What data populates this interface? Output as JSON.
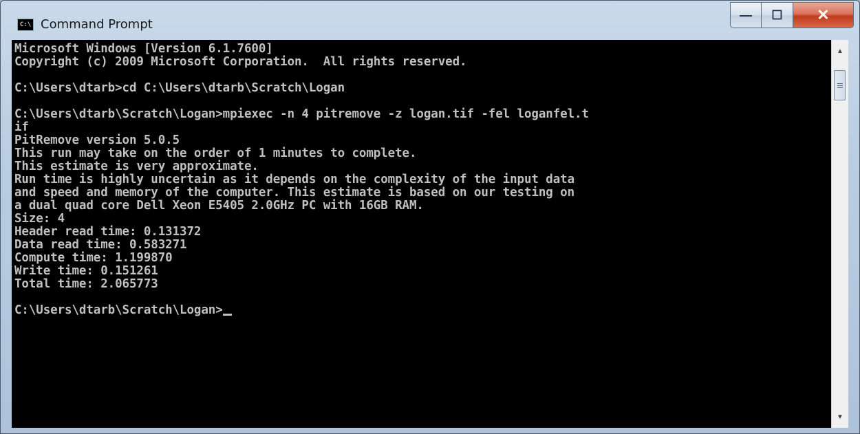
{
  "window": {
    "title": "Command Prompt",
    "icon": "console-app-icon",
    "icon_text": "C:\\",
    "minimize_glyph": "—",
    "maximize_glyph": "☐",
    "close_glyph": "✕"
  },
  "console": {
    "lines": [
      "Microsoft Windows [Version 6.1.7600]",
      "Copyright (c) 2009 Microsoft Corporation.  All rights reserved.",
      "",
      "C:\\Users\\dtarb>cd C:\\Users\\dtarb\\Scratch\\Logan",
      "",
      "C:\\Users\\dtarb\\Scratch\\Logan>mpiexec -n 4 pitremove -z logan.tif -fel loganfel.t",
      "if",
      "PitRemove version 5.0.5",
      "This run may take on the order of 1 minutes to complete.",
      "This estimate is very approximate.",
      "Run time is highly uncertain as it depends on the complexity of the input data",
      "and speed and memory of the computer. This estimate is based on our testing on",
      "a dual quad core Dell Xeon E5405 2.0GHz PC with 16GB RAM.",
      "Size: 4",
      "Header read time: 0.131372",
      "Data read time: 0.583271",
      "Compute time: 1.199870",
      "Write time: 0.151261",
      "Total time: 2.065773",
      "",
      "C:\\Users\\dtarb\\Scratch\\Logan>"
    ]
  },
  "scrollbar": {
    "up_glyph": "▲",
    "down_glyph": "▼"
  }
}
